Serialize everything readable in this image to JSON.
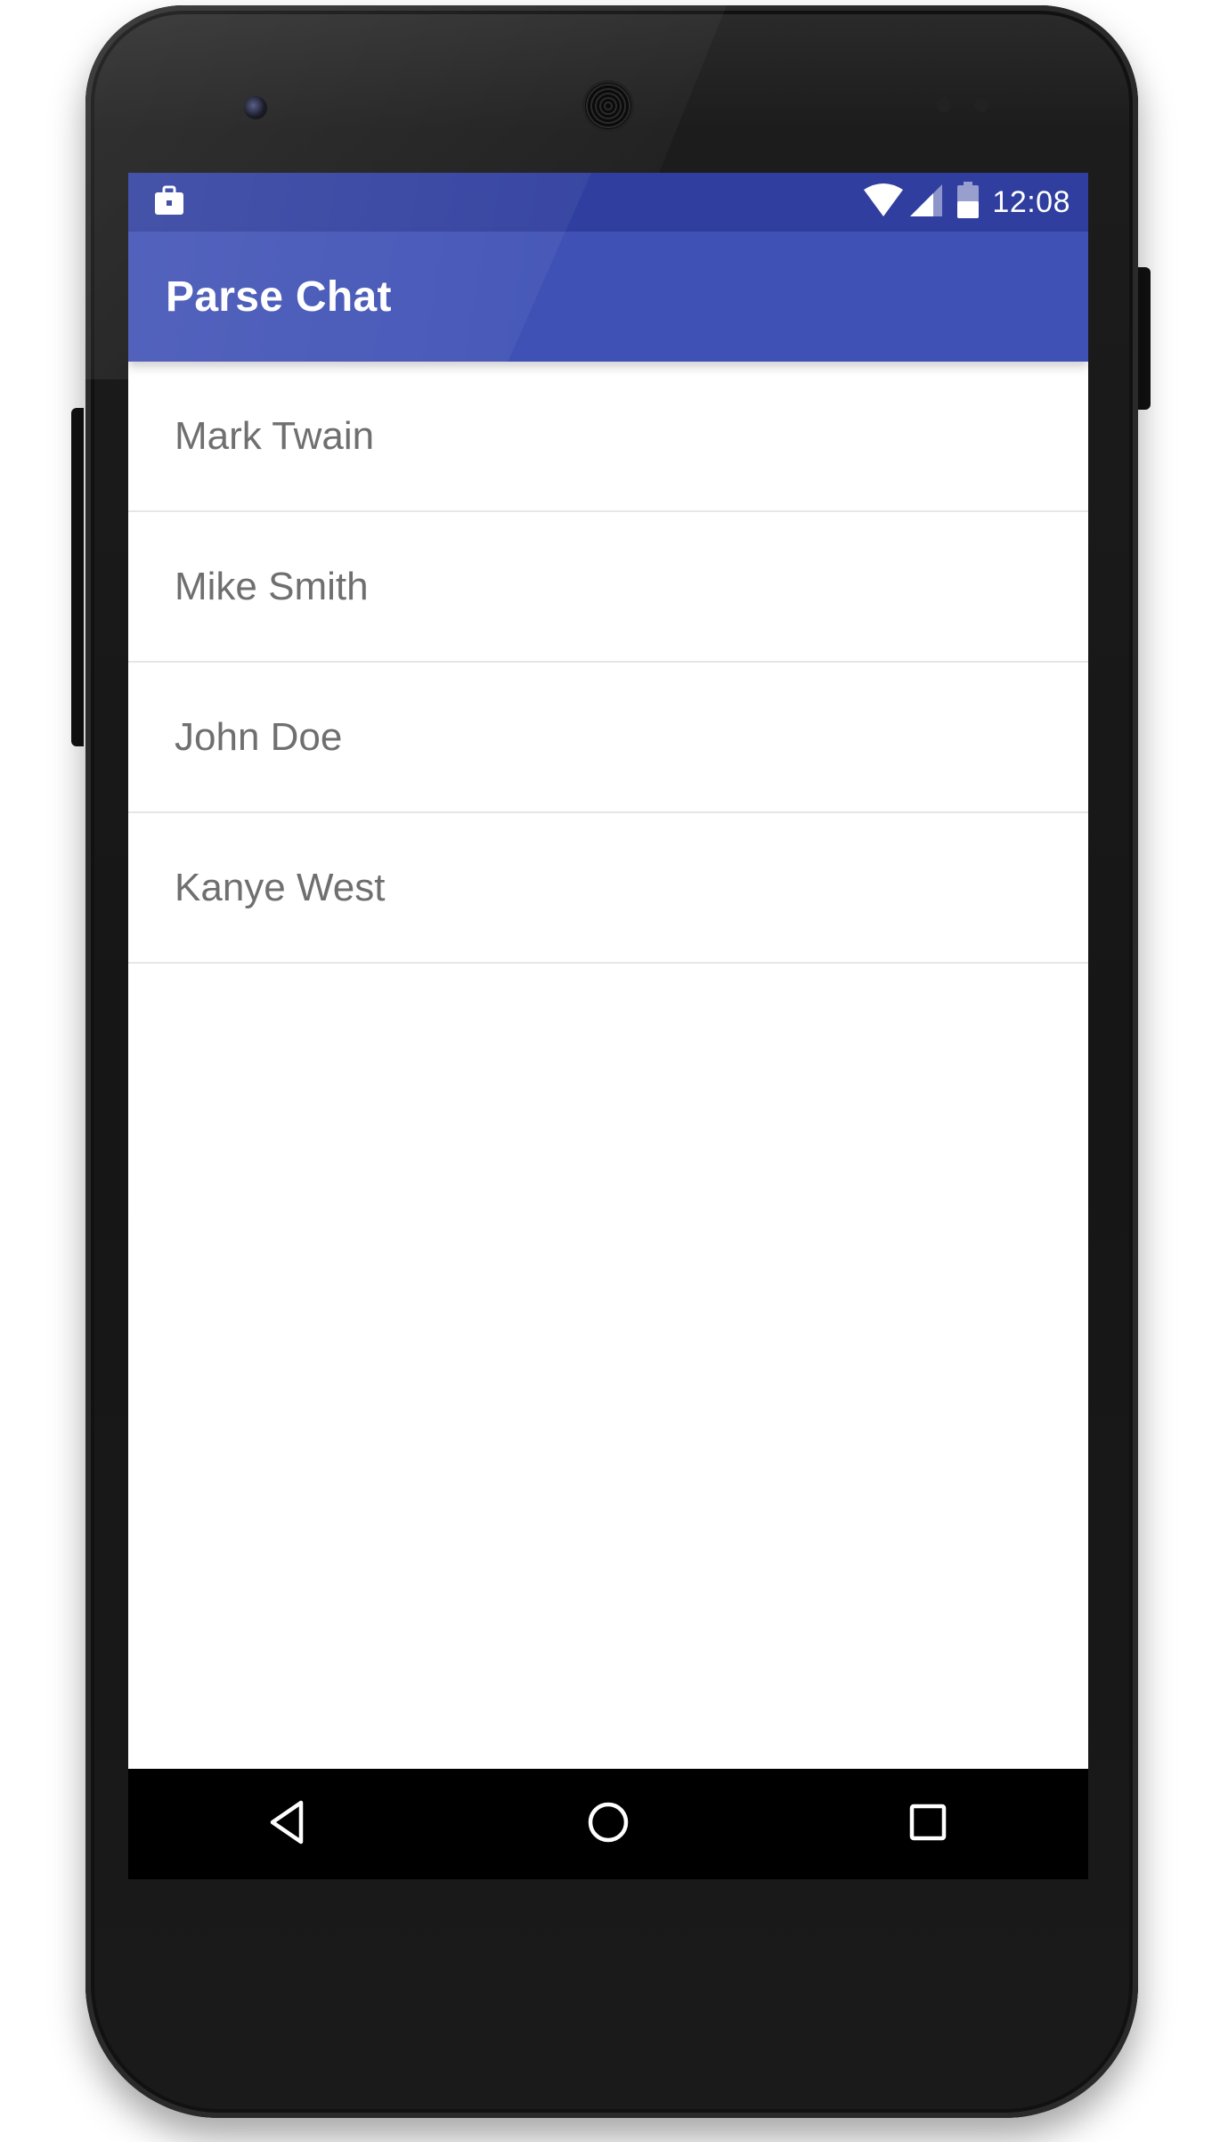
{
  "status_bar": {
    "time": "12:08",
    "icons": [
      "briefcase-icon",
      "wifi-icon",
      "cell-signal-icon",
      "battery-icon"
    ]
  },
  "app_bar": {
    "title": "Parse Chat",
    "color": "#3f51b5",
    "status_color": "#303f9f"
  },
  "contacts": [
    {
      "name": "Mark Twain"
    },
    {
      "name": "Mike Smith"
    },
    {
      "name": "John Doe"
    },
    {
      "name": "Kanye West"
    }
  ],
  "nav_bar": {
    "buttons": [
      "back-icon",
      "home-icon",
      "recents-icon"
    ]
  }
}
